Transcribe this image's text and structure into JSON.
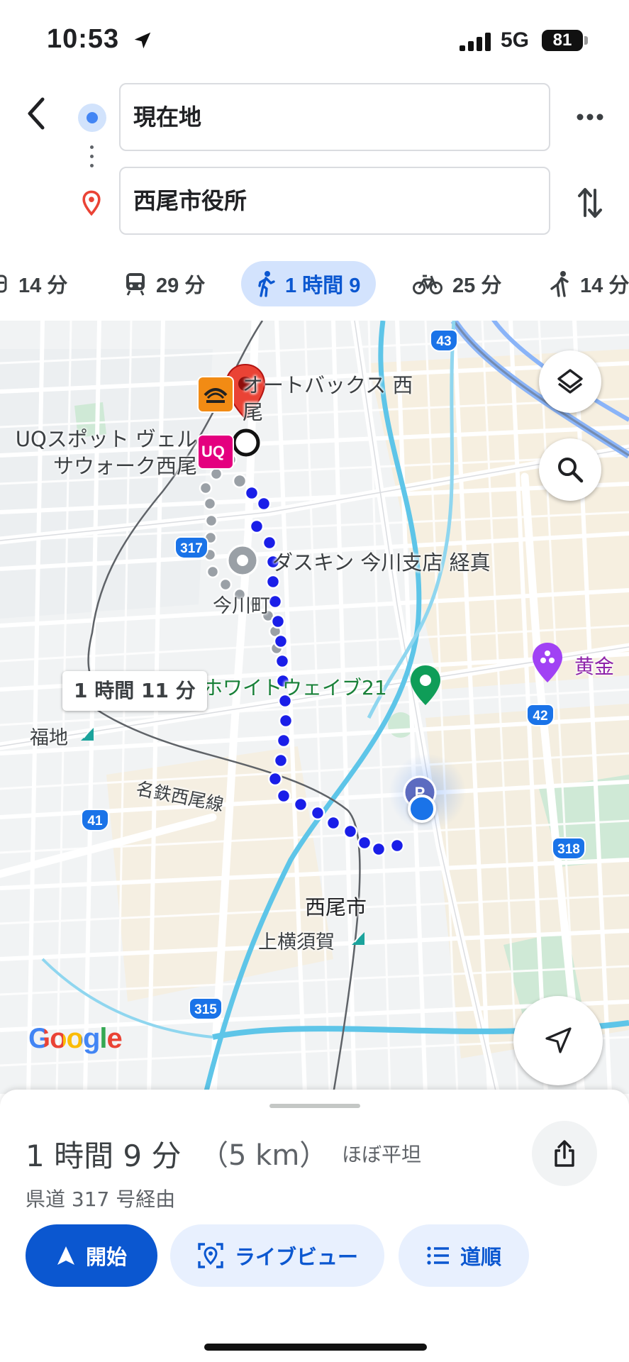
{
  "status_bar": {
    "time": "10:53",
    "network": "5G",
    "battery": "81"
  },
  "route_inputs": {
    "origin": "現在地",
    "destination": "西尾市役所"
  },
  "modes": [
    {
      "name": "car",
      "label": "14 分"
    },
    {
      "name": "transit",
      "label": "29 分"
    },
    {
      "name": "walk",
      "label": "1 時間 9",
      "selected": true
    },
    {
      "name": "bike",
      "label": "25 分"
    },
    {
      "name": "ride",
      "label": "14 分"
    }
  ],
  "map": {
    "places": {
      "autobacs": "オートバックス 西尾",
      "uq": "UQスポット ヴェルサウォーク西尾",
      "uq_logo": "UQ",
      "daskin": "ダスキン 今川支店 経真",
      "imagawa": "今川町",
      "whitewave": "ホワイトウェイブ21",
      "golden": "黄金",
      "fukuchi": "福地",
      "meitetsu": "名鉄西尾線",
      "nishio_city": "西尾市",
      "kamiyokosuka": "上横須賀"
    },
    "roads": [
      "43",
      "317",
      "42",
      "41",
      "318",
      "315"
    ],
    "alt_route_label": "1 時間 11 分",
    "google_logo": "Google",
    "colors": {
      "route": "#1a1ee8",
      "alt_route": "#9aa0a6",
      "water": "#5ec5e8",
      "park": "#c8ead3",
      "pin": "#ea4335"
    }
  },
  "summary": {
    "duration": "1 時間 9 分",
    "distance": "（5 km）",
    "terrain": "ほぼ平坦",
    "via": "県道 317 号経由"
  },
  "actions": {
    "start": "開始",
    "live_view": "ライブビュー",
    "steps": "道順"
  }
}
